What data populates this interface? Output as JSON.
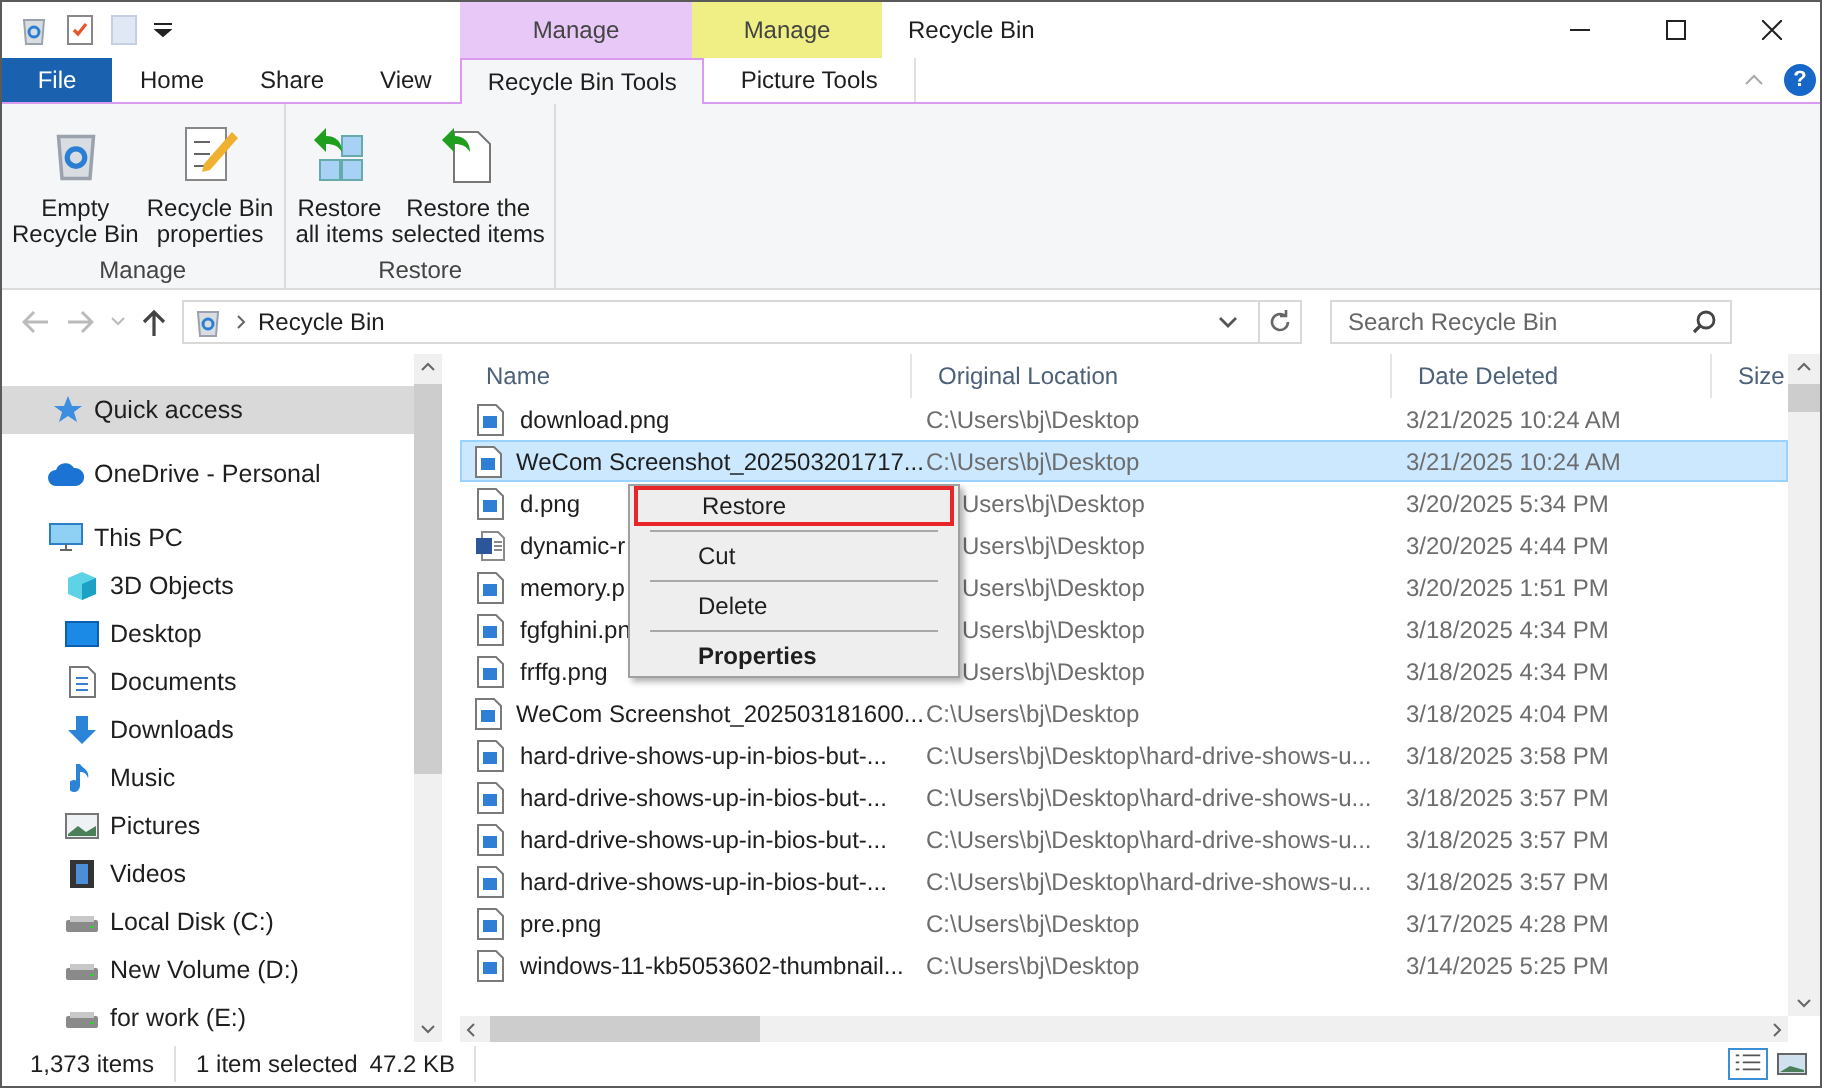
{
  "window": {
    "title": "Recycle Bin"
  },
  "context_tabs": [
    {
      "label": "Manage",
      "color": "#e8c8f7"
    },
    {
      "label": "Manage",
      "color": "#f0ef85"
    }
  ],
  "ribbon_tabs": [
    {
      "label": "File",
      "kind": "file",
      "selected": false
    },
    {
      "label": "Home",
      "kind": "tab",
      "selected": false
    },
    {
      "label": "Share",
      "kind": "tab",
      "selected": false
    },
    {
      "label": "View",
      "kind": "tab",
      "selected": false
    },
    {
      "label": "Recycle Bin Tools",
      "kind": "tab",
      "selected": true
    },
    {
      "label": "Picture Tools",
      "kind": "tab",
      "selected": false
    }
  ],
  "help": {
    "label": "?"
  },
  "ribbon_groups": [
    {
      "label": "Manage",
      "buttons": [
        {
          "label": "Empty\nRecycle Bin"
        },
        {
          "label": "Recycle Bin\nproperties"
        }
      ]
    },
    {
      "label": "Restore",
      "buttons": [
        {
          "label": "Restore\nall items"
        },
        {
          "label": "Restore the\nselected items"
        }
      ]
    }
  ],
  "address": {
    "path": "Recycle Bin"
  },
  "search": {
    "placeholder": "Search Recycle Bin"
  },
  "nav": [
    {
      "label": "Quick access",
      "selected": true
    },
    {
      "label": "OneDrive - Personal",
      "selected": false
    },
    {
      "label": "This PC",
      "selected": false,
      "children": [
        {
          "label": "3D Objects",
          "selected": false
        },
        {
          "label": "Desktop",
          "selected": false
        },
        {
          "label": "Documents",
          "selected": false
        },
        {
          "label": "Downloads",
          "selected": false
        },
        {
          "label": "Music",
          "selected": false
        },
        {
          "label": "Pictures",
          "selected": false
        },
        {
          "label": "Videos",
          "selected": false
        },
        {
          "label": "Local Disk (C:)",
          "selected": false
        },
        {
          "label": "New Volume (D:)",
          "selected": false
        },
        {
          "label": "for work (E:)",
          "selected": false
        }
      ]
    }
  ],
  "columns": [
    "Name",
    "Original Location",
    "Date Deleted",
    "Size"
  ],
  "rows": [
    {
      "name": "download.png",
      "kind": "image",
      "location": "C:\\Users\\bj\\Desktop",
      "date": "3/21/2025 10:24 AM",
      "selected": false,
      "covered": false
    },
    {
      "name": "WeCom Screenshot_202503201717...",
      "kind": "image",
      "location": "C:\\Users\\bj\\Desktop",
      "date": "3/21/2025 10:24 AM",
      "selected": true,
      "covered": false
    },
    {
      "name": "d.png",
      "kind": "image",
      "location": "Users\\bj\\Desktop",
      "date": "3/20/2025 5:34 PM",
      "selected": false,
      "covered": true
    },
    {
      "name": "dynamic-r",
      "kind": "word",
      "location": "Users\\bj\\Desktop",
      "date": "3/20/2025 4:44 PM",
      "selected": false,
      "covered": true
    },
    {
      "name": "memory.p",
      "kind": "image",
      "location": "Users\\bj\\Desktop",
      "date": "3/20/2025 1:51 PM",
      "selected": false,
      "covered": true
    },
    {
      "name": "fgfghini.pn",
      "kind": "image",
      "location": "Users\\bj\\Desktop",
      "date": "3/18/2025 4:34 PM",
      "selected": false,
      "covered": true
    },
    {
      "name": "frffg.png",
      "kind": "image",
      "location": "Users\\bj\\Desktop",
      "date": "3/18/2025 4:34 PM",
      "selected": false,
      "covered": true
    },
    {
      "name": "WeCom Screenshot_202503181600...",
      "kind": "image",
      "location": "C:\\Users\\bj\\Desktop",
      "date": "3/18/2025 4:04 PM",
      "selected": false,
      "covered": false
    },
    {
      "name": "hard-drive-shows-up-in-bios-but-...",
      "kind": "image",
      "location": "C:\\Users\\bj\\Desktop\\hard-drive-shows-u...",
      "date": "3/18/2025 3:58 PM",
      "selected": false,
      "covered": false
    },
    {
      "name": "hard-drive-shows-up-in-bios-but-...",
      "kind": "image",
      "location": "C:\\Users\\bj\\Desktop\\hard-drive-shows-u...",
      "date": "3/18/2025 3:57 PM",
      "selected": false,
      "covered": false
    },
    {
      "name": "hard-drive-shows-up-in-bios-but-...",
      "kind": "image",
      "location": "C:\\Users\\bj\\Desktop\\hard-drive-shows-u...",
      "date": "3/18/2025 3:57 PM",
      "selected": false,
      "covered": false
    },
    {
      "name": "hard-drive-shows-up-in-bios-but-...",
      "kind": "image",
      "location": "C:\\Users\\bj\\Desktop\\hard-drive-shows-u...",
      "date": "3/18/2025 3:57 PM",
      "selected": false,
      "covered": false
    },
    {
      "name": "pre.png",
      "kind": "image",
      "location": "C:\\Users\\bj\\Desktop",
      "date": "3/17/2025 4:28 PM",
      "selected": false,
      "covered": false
    },
    {
      "name": "windows-11-kb5053602-thumbnail...",
      "kind": "image",
      "location": "C:\\Users\\bj\\Desktop",
      "date": "3/14/2025 5:25 PM",
      "selected": false,
      "covered": false
    }
  ],
  "context_menu": [
    {
      "label": "Restore",
      "highlighted": true,
      "bold": false
    },
    {
      "label": "Cut",
      "highlighted": false,
      "bold": false
    },
    {
      "label": "Delete",
      "highlighted": false,
      "bold": false
    },
    {
      "label": "Properties",
      "highlighted": false,
      "bold": true
    }
  ],
  "status_bar": {
    "count": "1,373 items",
    "selection": "1 item selected",
    "size": "47.2 KB"
  }
}
